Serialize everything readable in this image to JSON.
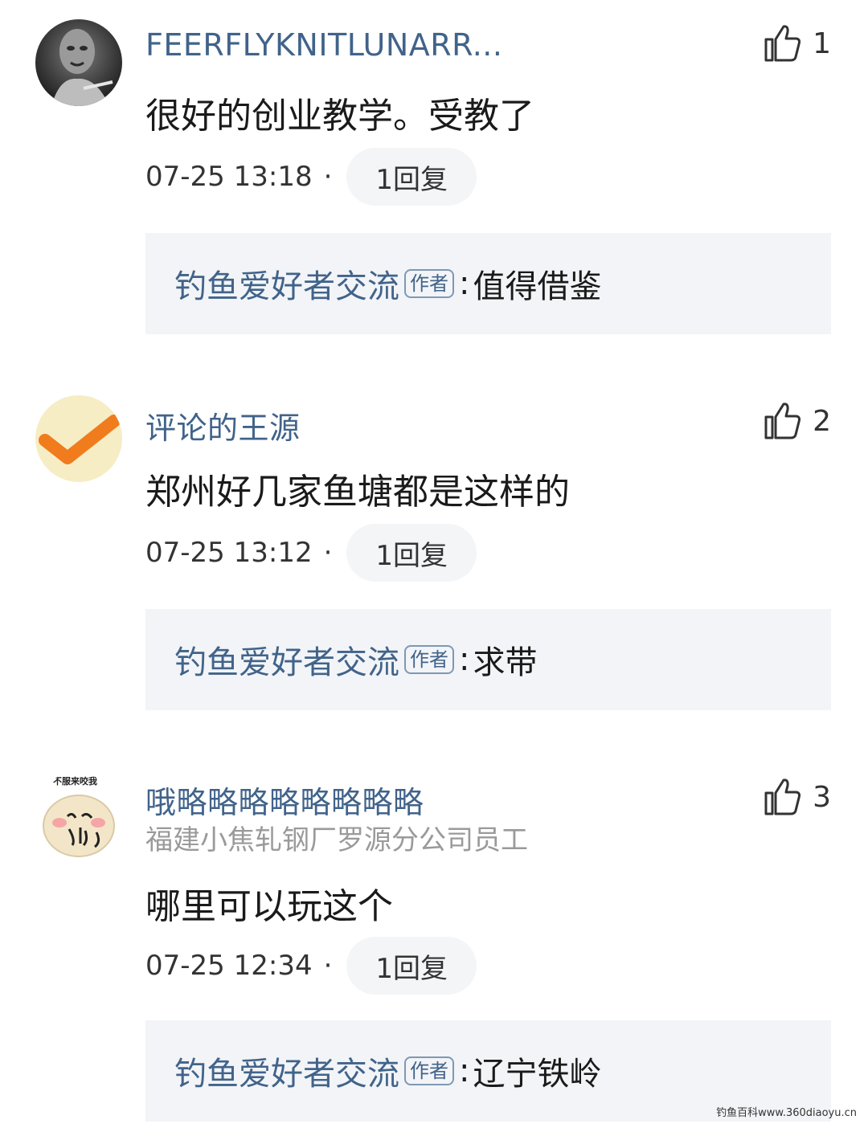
{
  "comments": [
    {
      "username": "FEERFLYKNITLUNARR...",
      "user_title": "",
      "likes": "1",
      "content": "很好的创业教学。受教了",
      "time": "07-25 13:18",
      "separator": "·",
      "reply_button": "1回复",
      "reply": {
        "author": "钓鱼爱好者交流",
        "badge": "作者",
        "colon": ":",
        "text": "值得借鉴"
      }
    },
    {
      "username": "评论的王源",
      "user_title": "",
      "likes": "2",
      "content": "郑州好几家鱼塘都是这样的",
      "time": "07-25 13:12",
      "separator": "·",
      "reply_button": "1回复",
      "reply": {
        "author": "钓鱼爱好者交流",
        "badge": "作者",
        "colon": ":",
        "text": "求带"
      }
    },
    {
      "username": "哦略略略略略略略略",
      "user_title": "福建小焦轧钢厂罗源分公司员工",
      "likes": "3",
      "content": "哪里可以玩这个",
      "time": "07-25 12:34",
      "separator": "·",
      "reply_button": "1回复",
      "reply": {
        "author": "钓鱼爱好者交流",
        "badge": "作者",
        "colon": ":",
        "text": "辽宁铁岭"
      }
    }
  ],
  "avatar_sticker_text": "不服来咬我",
  "watermark": "钓鱼百科www.360diaoyu.cn",
  "icons": {
    "like": "thumbs-up-outline-icon"
  },
  "colors": {
    "username": "#41638a",
    "reply_bg": "#f2f4f7",
    "reply_button_bg": "#f3f5f7",
    "checkmark": "#f07c1e",
    "checkmark_avatar_bg": "#f6edc5"
  }
}
